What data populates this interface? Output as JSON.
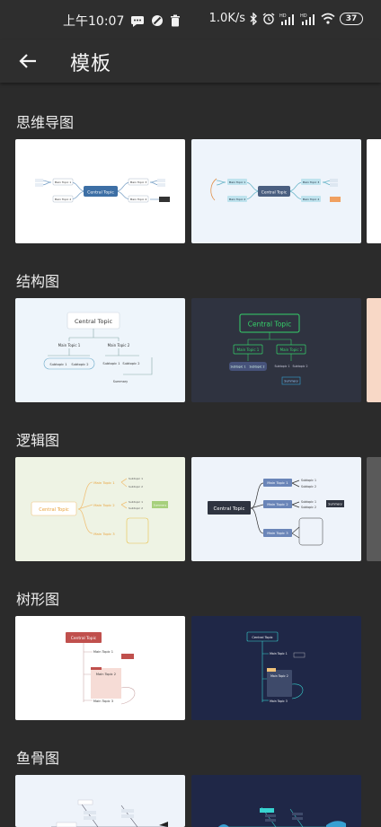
{
  "status_bar": {
    "time": "上午10:07",
    "net_speed": "1.0K/s",
    "battery": "37"
  },
  "app_bar": {
    "title": "模板",
    "back_icon": "arrow-left-icon"
  },
  "sections": [
    {
      "title": "思维导图",
      "templates": [
        {
          "central": "Central Topic",
          "main": [
            "Main Topic 1",
            "Main Topic 2",
            "Main Topic 3",
            "Main Topic 4"
          ],
          "summary": "Summary",
          "theme": "white"
        },
        {
          "central": "Central Topic",
          "main": [
            "Main Topic 1",
            "Main Topic 2",
            "Main Topic 3",
            "Main Topic 4"
          ],
          "summary": "Summary",
          "theme": "light-blue"
        }
      ]
    },
    {
      "title": "结构图",
      "templates": [
        {
          "central": "Central Topic",
          "main": [
            "Main Topic 1",
            "Main Topic 2"
          ],
          "sub": [
            "Subtopic 1",
            "Subtopic 2",
            "Subtopic 1",
            "Subtopic 2"
          ],
          "summary": "Summary",
          "theme": "light"
        },
        {
          "central": "Central Topic",
          "main": [
            "Main Topic 1",
            "Main Topic 2"
          ],
          "sub": [
            "Subtopic 1",
            "Subtopic 2",
            "Subtopic 1",
            "Subtopic 2"
          ],
          "summary": "Summary",
          "theme": "dark-green"
        }
      ]
    },
    {
      "title": "逻辑图",
      "templates": [
        {
          "central": "Central Topic",
          "main": [
            "Main Topic 1",
            "Main Topic 2",
            "Main Topic 3"
          ],
          "sub": [
            "Subtopic 1",
            "Subtopic 2",
            "Subtopic 1",
            "Subtopic 2"
          ],
          "summary": "Summary",
          "theme": "green"
        },
        {
          "central": "Central Topic",
          "main": [
            "Main Topic 1",
            "Main Topic 2",
            "Main Topic 3"
          ],
          "sub": [
            "Subtopic 1",
            "Subtopic 2",
            "Subtopic 1",
            "Subtopic 2"
          ],
          "summary": "Summary",
          "theme": "slate"
        }
      ]
    },
    {
      "title": "树形图",
      "templates": [
        {
          "central": "Central Topic",
          "main": [
            "Main Topic 1",
            "Main Topic 2",
            "Main Topic 3"
          ],
          "summary": "Summary",
          "theme": "red"
        },
        {
          "central": "Central Topic",
          "main": [
            "Main Topic 1",
            "Main Topic 2",
            "Main Topic 3"
          ],
          "summary": "Summary",
          "theme": "navy"
        }
      ]
    },
    {
      "title": "鱼骨图",
      "templates": [
        {
          "theme": "light-blue"
        },
        {
          "theme": "navy"
        }
      ]
    }
  ],
  "colors": {
    "background": "#2b2b2b",
    "bar": "#2e2e2e",
    "text": "#eeeeee"
  }
}
